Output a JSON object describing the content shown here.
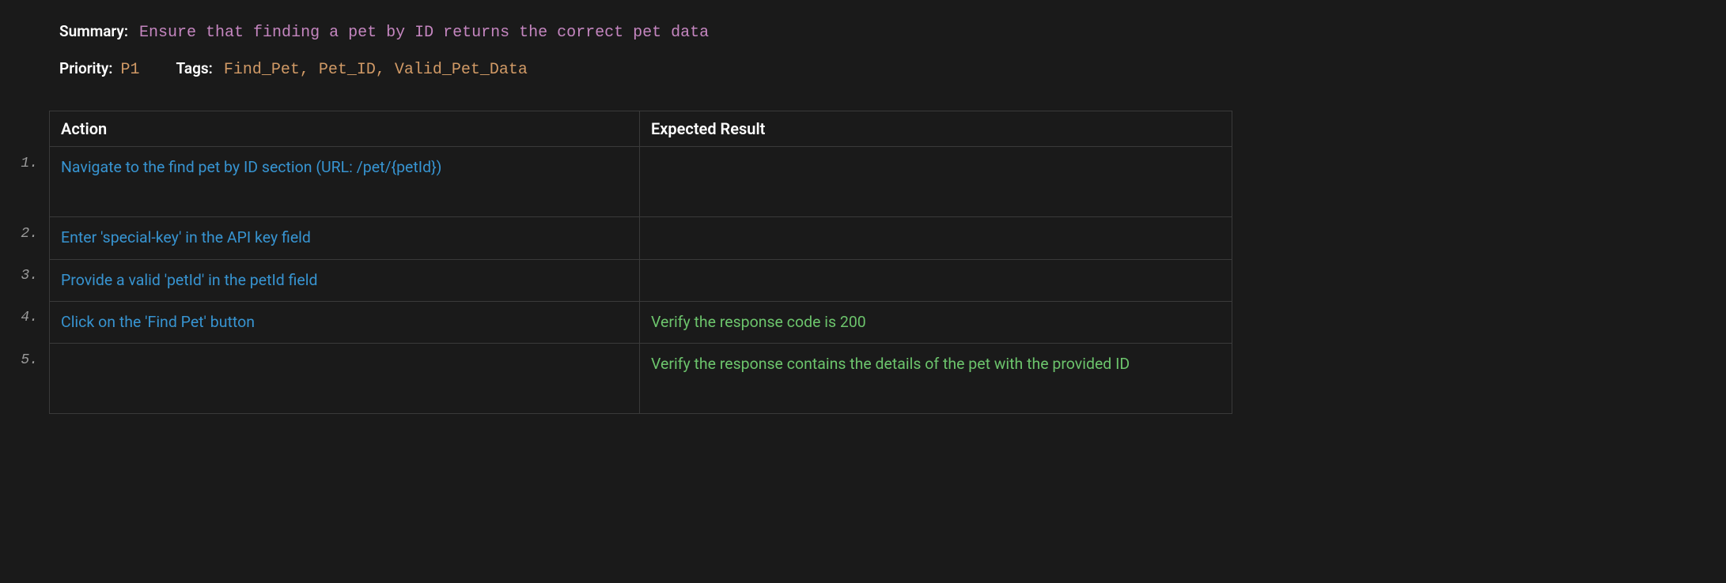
{
  "labels": {
    "summary": "Summary:",
    "priority": "Priority:",
    "tags": "Tags:"
  },
  "summary": "Ensure that finding a pet by ID returns the correct pet data",
  "priority": "P1",
  "tags": "Find_Pet, Pet_ID, Valid_Pet_Data",
  "table": {
    "headers": {
      "action": "Action",
      "expected": "Expected Result"
    },
    "rows": [
      {
        "num": "1.",
        "action": "Navigate to the find pet by ID section (URL: /pet/{petId})",
        "expected": "",
        "tall": true
      },
      {
        "num": "2.",
        "action": "Enter 'special-key' in the API key field",
        "expected": "",
        "tall": false
      },
      {
        "num": "3.",
        "action": "Provide a valid 'petId' in the petId field",
        "expected": "",
        "tall": false
      },
      {
        "num": "4.",
        "action": "Click on the 'Find Pet' button",
        "expected": "Verify the response code is 200",
        "tall": false
      },
      {
        "num": "5.",
        "action": "",
        "expected": "Verify the response contains the details of the pet with the provided ID",
        "tall": true
      }
    ]
  }
}
